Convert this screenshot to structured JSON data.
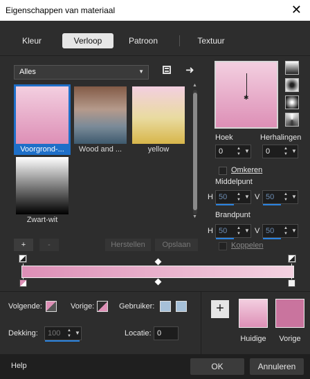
{
  "window": {
    "title": "Eigenschappen van materiaal",
    "close": "✕"
  },
  "tabs": [
    {
      "label": "Kleur"
    },
    {
      "label": "Verloop"
    },
    {
      "label": "Patroon"
    },
    {
      "label": "Textuur"
    }
  ],
  "library": {
    "category": "Alles",
    "items": [
      {
        "label": "Voorgrond-...",
        "selected": true
      },
      {
        "label": "Wood and ..."
      },
      {
        "label": "yellow"
      },
      {
        "label": "Zwart-wit"
      }
    ]
  },
  "list_buttons": {
    "add": "+",
    "remove": "-",
    "reset": "Herstellen",
    "save": "Opslaan"
  },
  "angle": {
    "label": "Hoek",
    "value": "0"
  },
  "repeats": {
    "label": "Herhalingen",
    "value": "0"
  },
  "invert": {
    "label": "Omkeren"
  },
  "midpoint": {
    "label": "Middelpunt",
    "h_label": "H",
    "h_value": "50",
    "v_label": "V",
    "v_value": "50"
  },
  "focus": {
    "label": "Brandpunt",
    "h_label": "H",
    "h_value": "50",
    "v_label": "V",
    "v_value": "50"
  },
  "link": {
    "label": "Koppelen"
  },
  "stops": {
    "next_label": "Volgende:",
    "prev_label": "Vorige:",
    "user_label": "Gebruiker:",
    "opacity_label": "Dekking:",
    "opacity_value": "100",
    "location_label": "Locatie:",
    "location_value": "0"
  },
  "colors": {
    "add": "+",
    "current_label": "Huidige",
    "previous_label": "Vorige",
    "current_hex": "#dd8fb6",
    "previous_hex": "#c9749e"
  },
  "footer": {
    "help": "Help",
    "ok": "OK",
    "cancel": "Annuleren"
  }
}
